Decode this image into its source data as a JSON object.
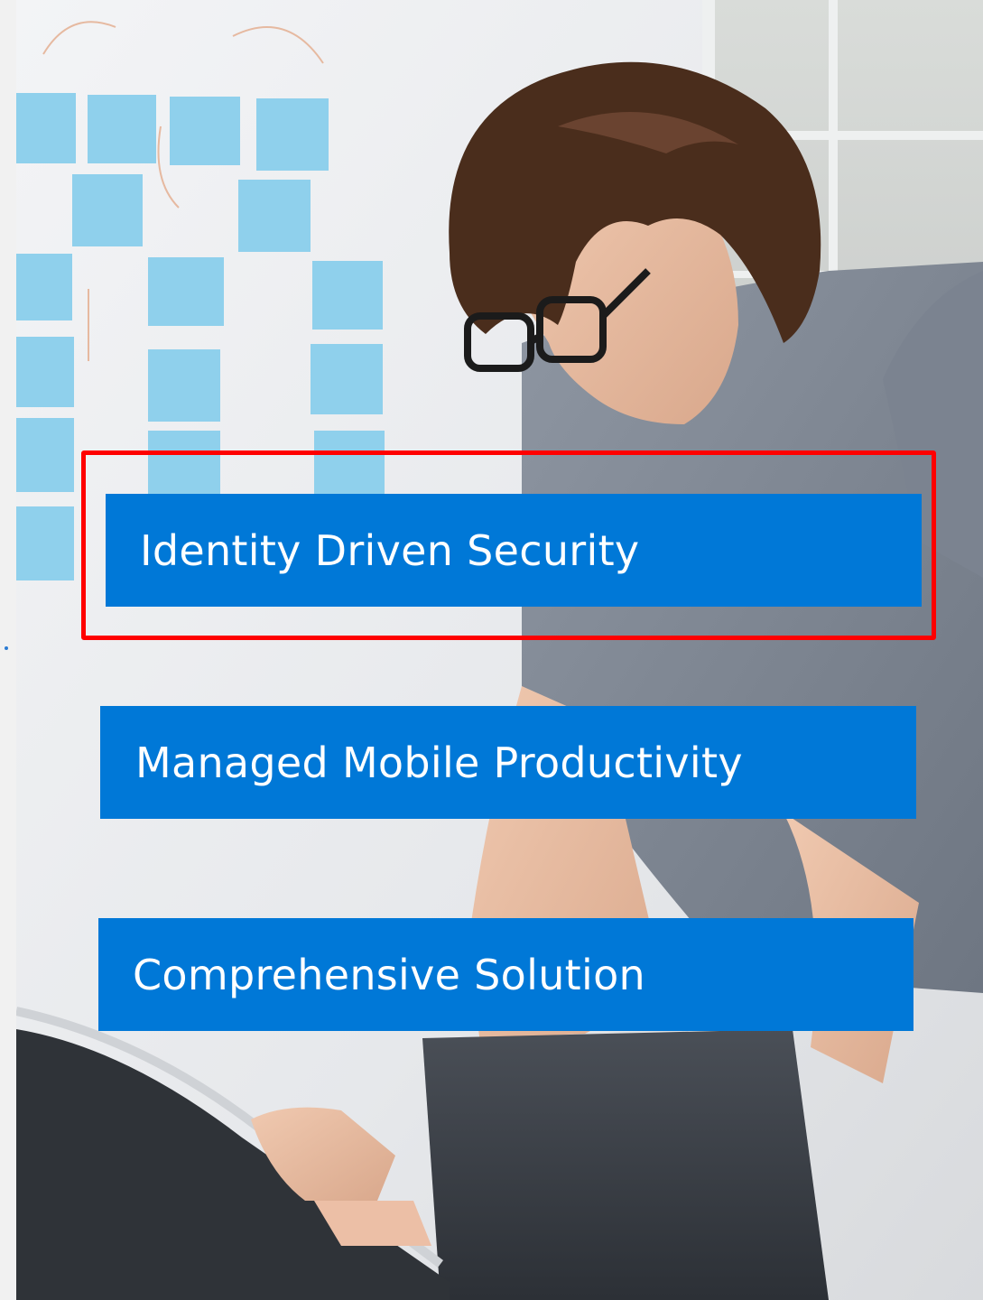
{
  "colors": {
    "banner_blue": "#0078d7",
    "highlight_red": "#ff0000",
    "dot_blue": "#2b7bd3"
  },
  "icons": {
    "accent_dot": "bullet-dot-icon"
  },
  "banners": [
    {
      "label": "Identity Driven Security",
      "highlighted": true
    },
    {
      "label": "Managed Mobile Productivity",
      "highlighted": false
    },
    {
      "label": "Comprehensive Solution",
      "highlighted": false
    }
  ]
}
